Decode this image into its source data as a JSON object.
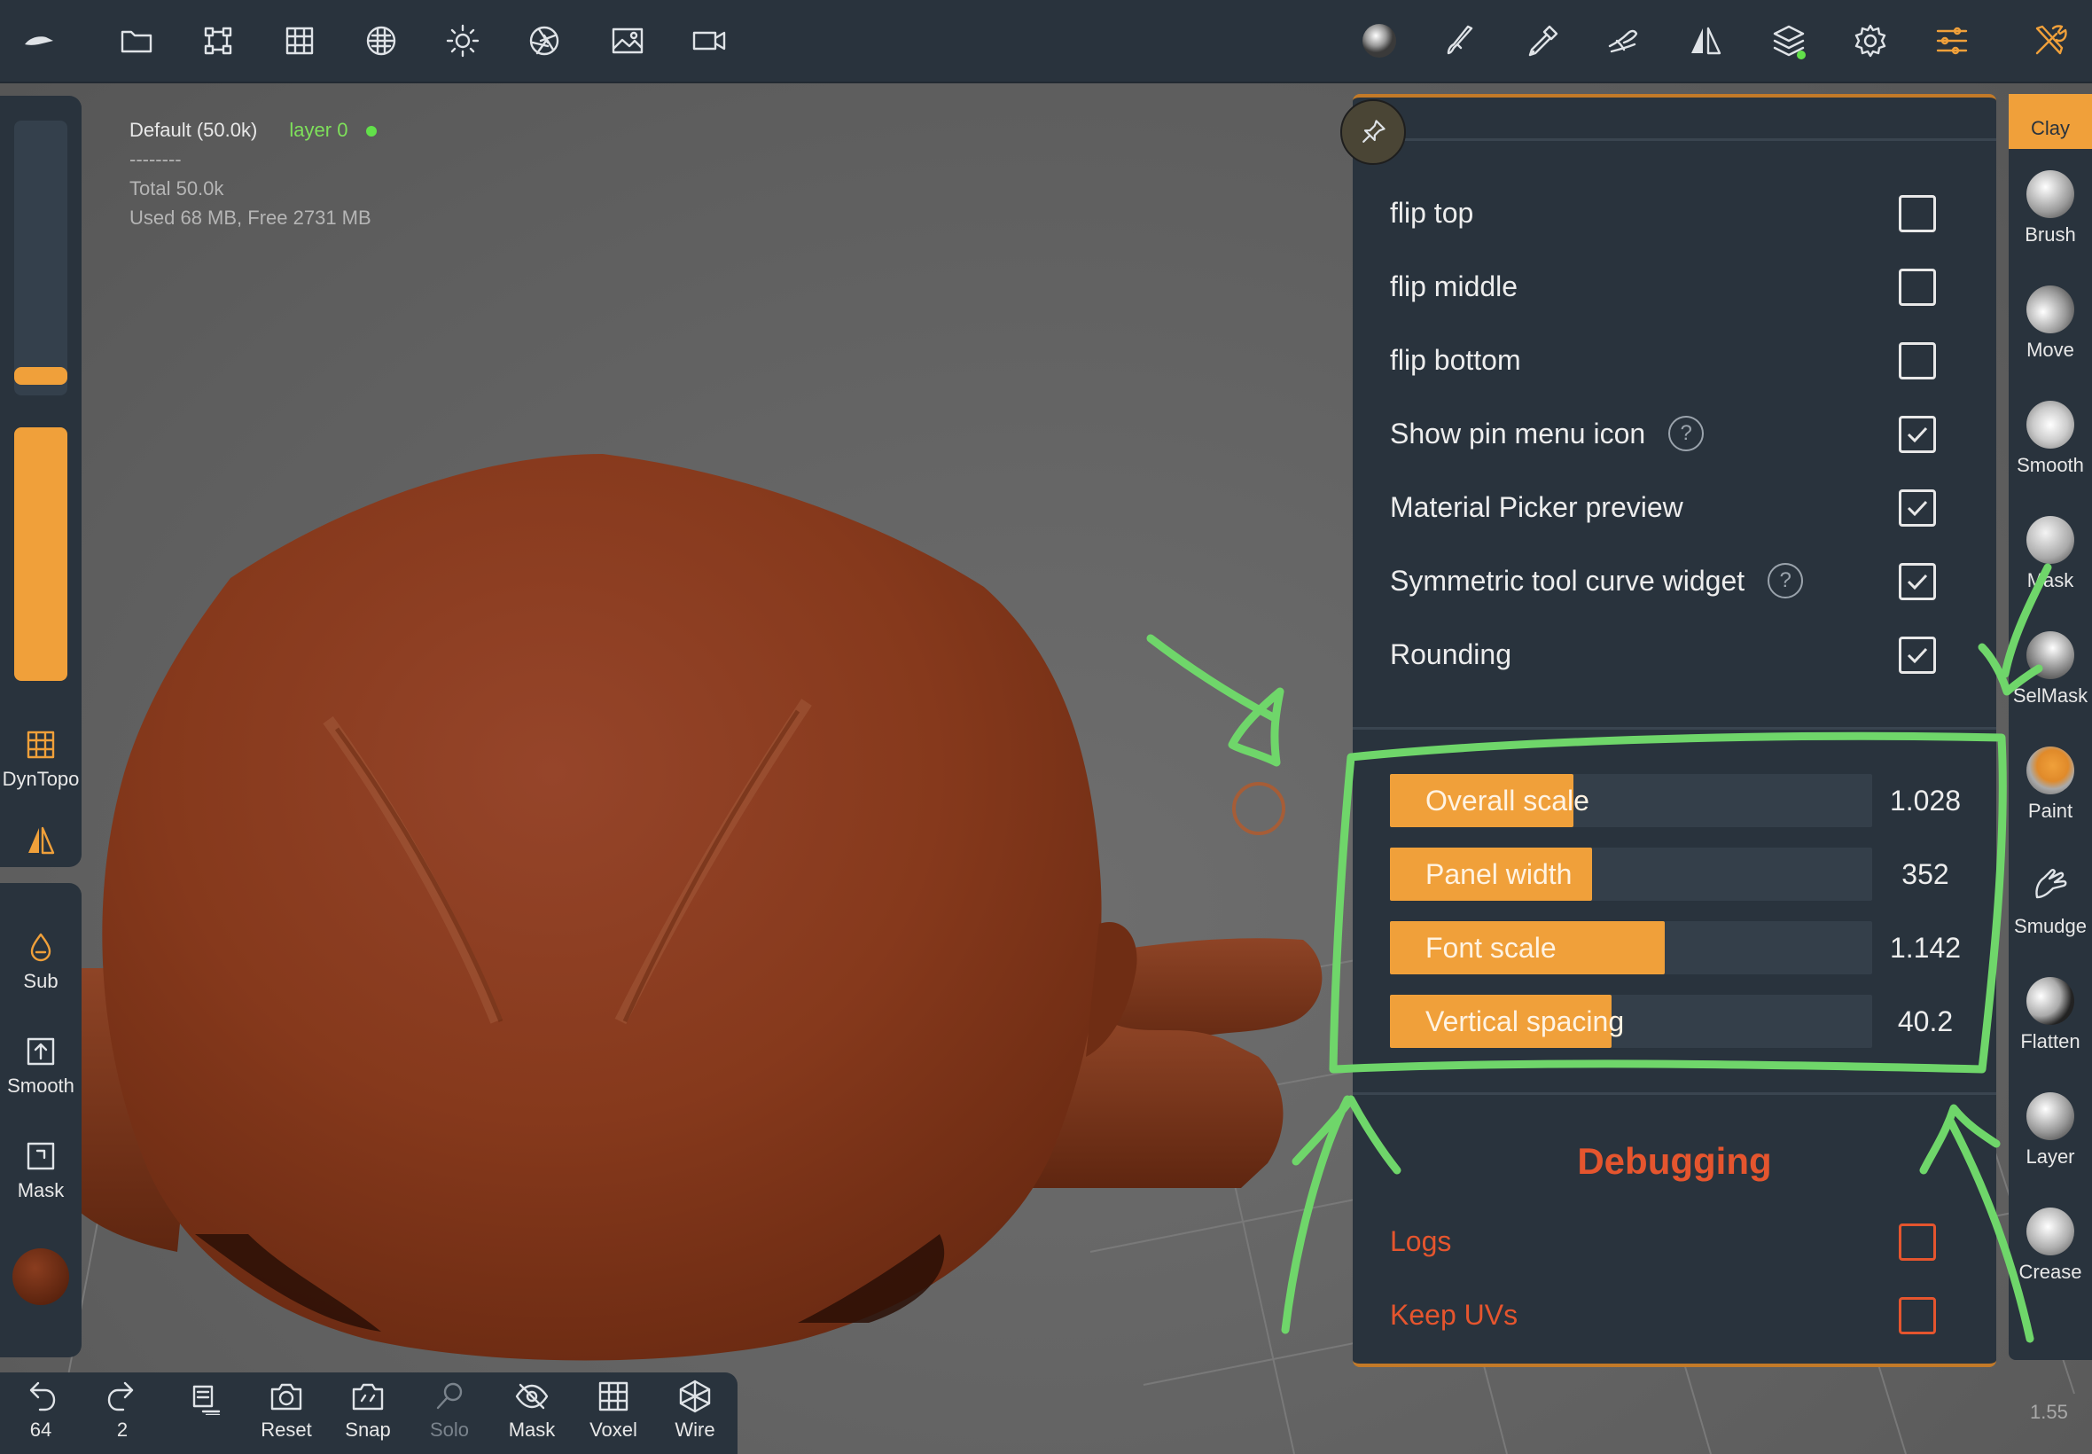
{
  "scene": {
    "object_name": "Default (50.0k)",
    "layer_name": "layer 0",
    "separator": "--------",
    "total": "Total 50.0k",
    "memory": "Used 68 MB,  Free 2731 MB"
  },
  "top_toolbar": {
    "icons": [
      "logo-icon",
      "folder-icon",
      "scene-tree-icon",
      "topology-grid-icon",
      "material-sphere-icon",
      "light-icon",
      "camera-aperture-icon",
      "background-image-icon",
      "video-camera-icon",
      "matcap-sphere-icon",
      "stroke-brush-icon",
      "picker-icon",
      "tool-settings-icon",
      "symmetry-icon",
      "layers-icon",
      "settings-gear-icon",
      "interface-sliders-icon",
      "tools-icon"
    ]
  },
  "left_toolbar": {
    "radius_level": 0.03,
    "intensity_level": 0.3,
    "dyntopo_label": "DynTopo",
    "sub_label": "Sub",
    "smooth_label": "Smooth",
    "mask_label": "Mask"
  },
  "bottom_toolbar": {
    "undo_count": "64",
    "redo_count": "2",
    "reset_label": "Reset",
    "snap_label": "Snap",
    "solo_label": "Solo",
    "mask_label": "Mask",
    "voxel_label": "Voxel",
    "wire_label": "Wire"
  },
  "panel": {
    "options": [
      {
        "label": "flip top",
        "checked": false,
        "help": false
      },
      {
        "label": "flip middle",
        "checked": false,
        "help": false
      },
      {
        "label": "flip bottom",
        "checked": false,
        "help": false
      },
      {
        "label": "Show pin menu icon",
        "checked": true,
        "help": true
      },
      {
        "label": "Material Picker preview",
        "checked": true,
        "help": false
      },
      {
        "label": "Symmetric tool curve widget",
        "checked": true,
        "help": true
      },
      {
        "label": "Rounding",
        "checked": true,
        "help": false
      }
    ],
    "help_glyph": "?",
    "sliders": [
      {
        "label": "Overall scale",
        "value": "1.028",
        "fill": 0.38
      },
      {
        "label": "Panel width",
        "value": "352",
        "fill": 0.42
      },
      {
        "label": "Font scale",
        "value": "1.142",
        "fill": 0.57
      },
      {
        "label": "Vertical spacing",
        "value": "40.2",
        "fill": 0.46
      }
    ],
    "debug_title": "Debugging",
    "debug_options": [
      {
        "label": "Logs",
        "checked": false
      },
      {
        "label": "Keep UVs",
        "checked": false
      }
    ]
  },
  "brushes": [
    {
      "label": "Clay",
      "active": true
    },
    {
      "label": "Brush",
      "active": false
    },
    {
      "label": "Move",
      "active": false
    },
    {
      "label": "Smooth",
      "active": false
    },
    {
      "label": "Mask",
      "active": false
    },
    {
      "label": "SelMask",
      "active": false
    },
    {
      "label": "Paint",
      "active": false
    },
    {
      "label": "Smudge",
      "active": false
    },
    {
      "label": "Flatten",
      "active": false
    },
    {
      "label": "Layer",
      "active": false
    },
    {
      "label": "Crease",
      "active": false
    }
  ],
  "version": "1.55",
  "colors": {
    "panel_bg": "#29333d",
    "accent_orange": "#f0a03a",
    "debug_red": "#e5552e",
    "annotation_green": "#6fd66a",
    "sculpt_clay": "#8a3d1f"
  }
}
